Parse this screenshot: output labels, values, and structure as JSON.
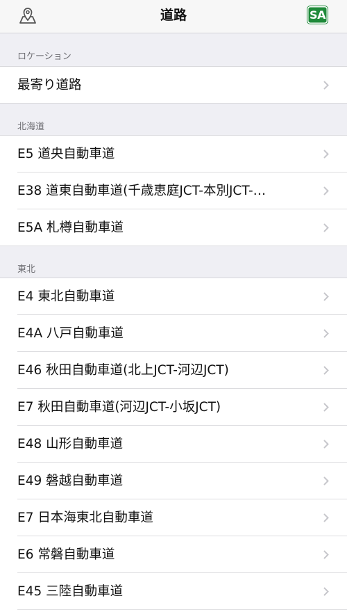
{
  "nav": {
    "title": "道路",
    "left_icon": "map-pin-icon",
    "right_badge": "SA"
  },
  "sections": [
    {
      "header": "ロケーション",
      "items": [
        "最寄り道路"
      ]
    },
    {
      "header": "北海道",
      "items": [
        "E5 道央自動車道",
        "E38 道東自動車道(千歳恵庭JCT-本別JCT-…",
        "E5A 札樽自動車道"
      ]
    },
    {
      "header": "東北",
      "items": [
        "E4 東北自動車道",
        "E4A 八戸自動車道",
        "E46 秋田自動車道(北上JCT-河辺JCT)",
        "E7 秋田自動車道(河辺JCT-小坂JCT)",
        "E48 山形自動車道",
        "E49 磐越自動車道",
        "E7 日本海東北自動車道",
        "E6 常磐自動車道",
        "E45 三陸自動車道"
      ]
    }
  ],
  "colors": {
    "sa_badge": "#1f8a3a",
    "background": "#efeff4",
    "chevron": "#c7c7cc"
  }
}
